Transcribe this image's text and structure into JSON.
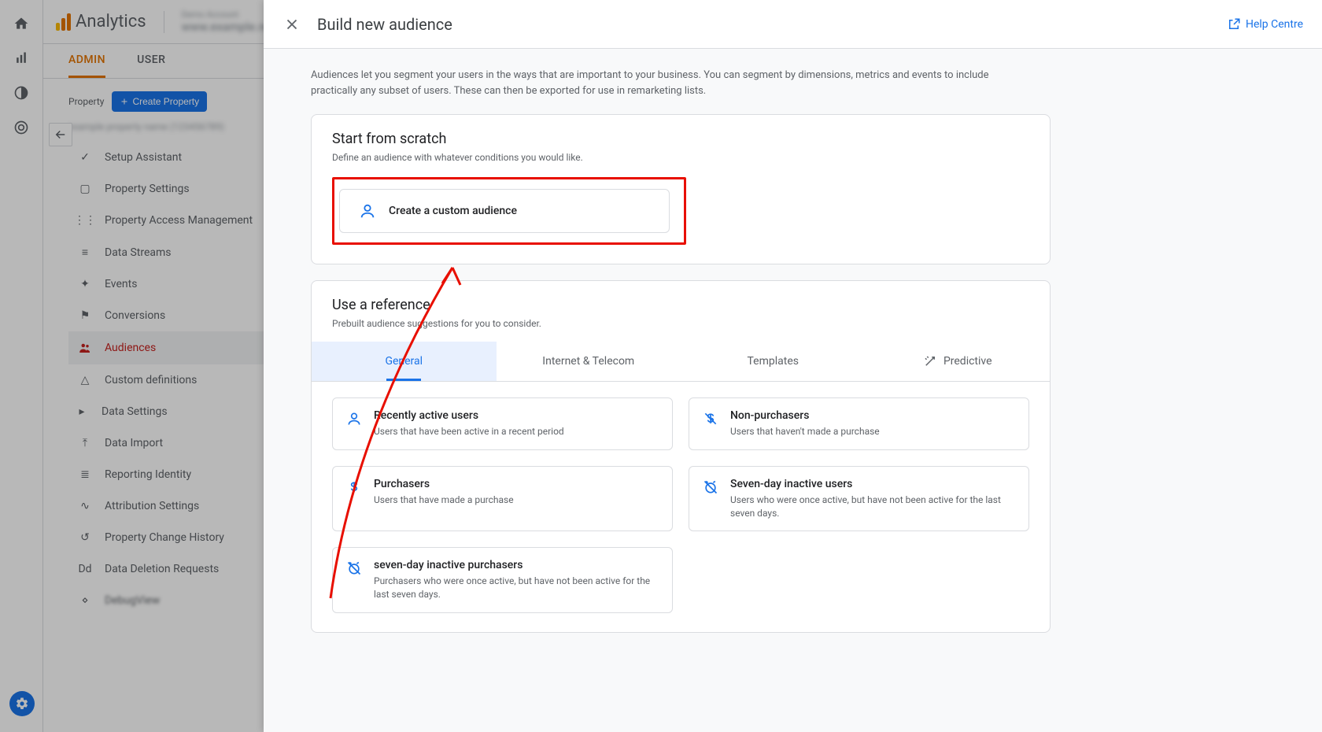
{
  "app": {
    "logo_text": "Analytics",
    "account_line1": "Demo Account",
    "account_line2": "www.example.net"
  },
  "tabs": {
    "admin": "ADMIN",
    "user": "USER"
  },
  "property": {
    "label": "Property",
    "create_btn": "Create Property",
    "blurred": "example property name (123456789)"
  },
  "nav": [
    {
      "label": "Setup Assistant"
    },
    {
      "label": "Property Settings"
    },
    {
      "label": "Property Access Management"
    },
    {
      "label": "Data Streams"
    },
    {
      "label": "Events"
    },
    {
      "label": "Conversions"
    },
    {
      "label": "Audiences"
    },
    {
      "label": "Custom definitions"
    },
    {
      "label": "Data Settings"
    },
    {
      "label": "Data Import"
    },
    {
      "label": "Reporting Identity"
    },
    {
      "label": "Attribution Settings"
    },
    {
      "label": "Property Change History"
    },
    {
      "label": "Data Deletion Requests"
    },
    {
      "label": "DebugView"
    }
  ],
  "modal": {
    "title": "Build new audience",
    "help": "Help Centre",
    "desc": "Audiences let you segment your users in the ways that are important to your business. You can segment by dimensions, metrics and events to include practically any subset of users. These can then be exported for use in remarketing lists."
  },
  "scratch": {
    "title": "Start from scratch",
    "sub": "Define an audience with whatever conditions you would like.",
    "btn": "Create a custom audience"
  },
  "reference": {
    "title": "Use a reference",
    "sub": "Prebuilt audience suggestions for you to consider.",
    "tabs": {
      "general": "General",
      "internet": "Internet & Telecom",
      "templates": "Templates",
      "predictive": "Predictive"
    }
  },
  "templates": [
    {
      "title": "Recently active users",
      "desc": "Users that have been active in a recent period"
    },
    {
      "title": "Non-purchasers",
      "desc": "Users that haven't made a purchase"
    },
    {
      "title": "Purchasers",
      "desc": "Users that have made a purchase"
    },
    {
      "title": "Seven-day inactive users",
      "desc": "Users who were once active, but have not been active for the last seven days."
    },
    {
      "title": "seven-day inactive purchasers",
      "desc": "Purchasers who were once active, but have not been active for the last seven days."
    }
  ]
}
